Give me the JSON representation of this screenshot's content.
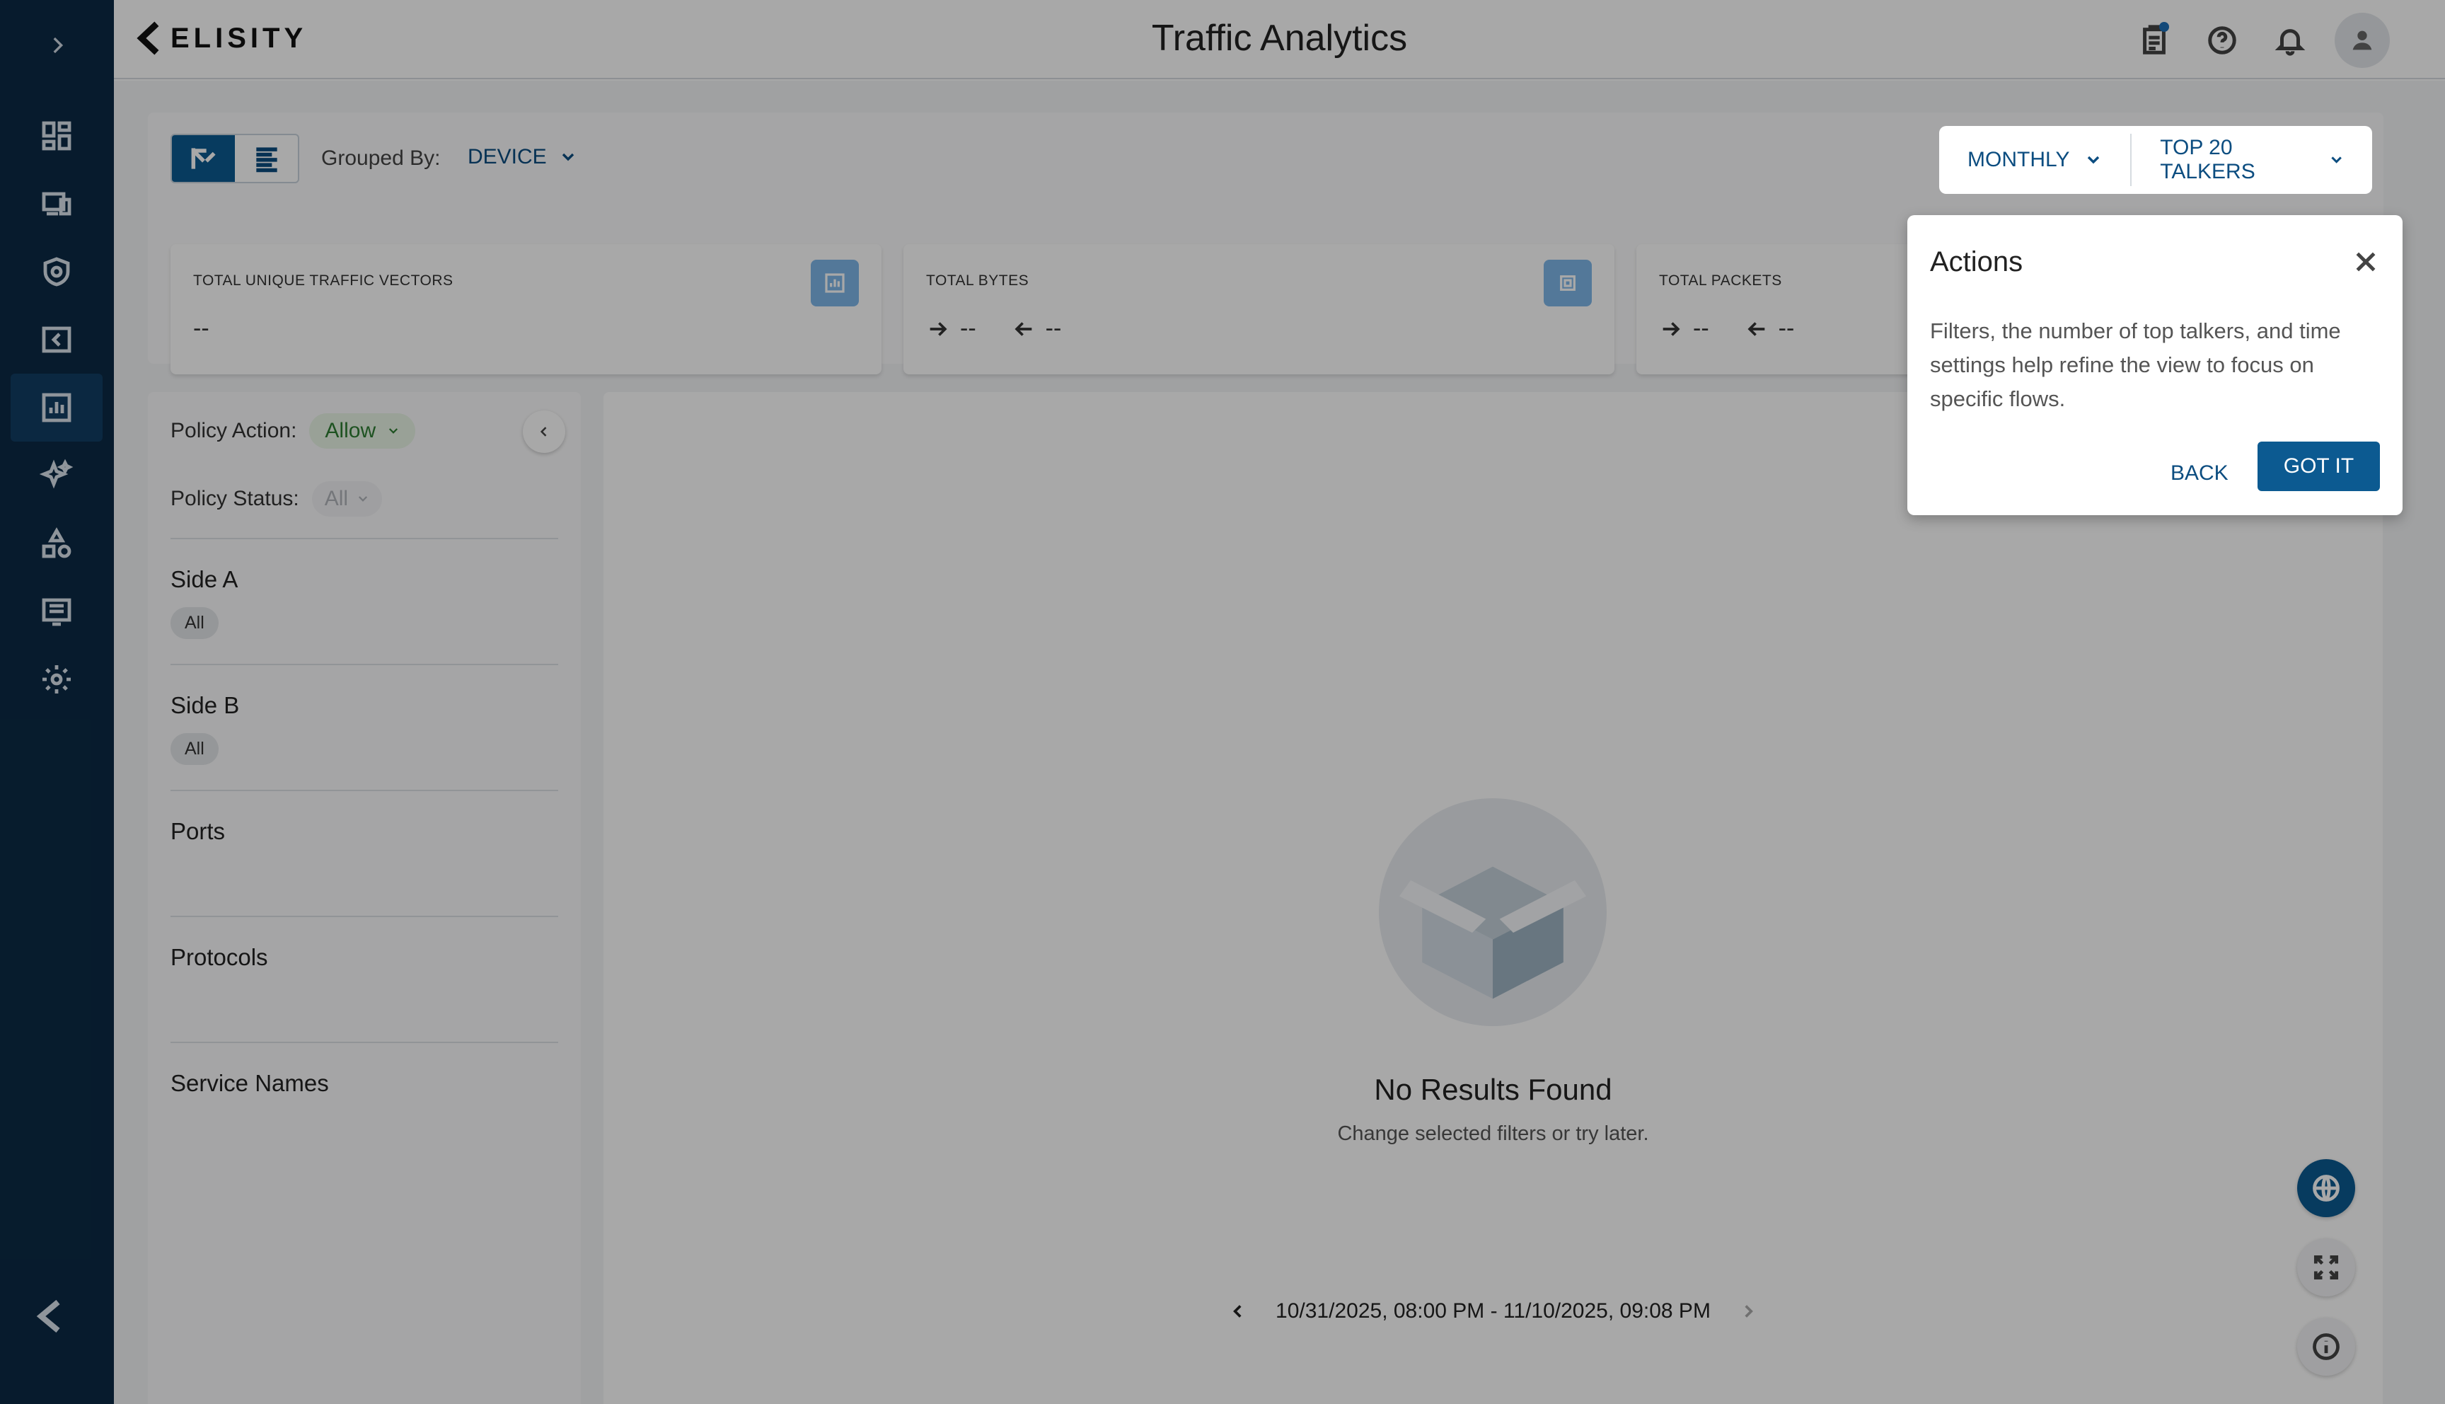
{
  "app": {
    "brand": "ELISITY",
    "title": "Traffic Analytics"
  },
  "header": {
    "icons": [
      "task-list-icon",
      "help-icon",
      "bell-icon",
      "user-avatar-icon"
    ]
  },
  "sidebar": {
    "items": [
      {
        "name": "dashboard-icon",
        "active": false
      },
      {
        "name": "devices-icon",
        "active": false
      },
      {
        "name": "policy-shield-icon",
        "active": false
      },
      {
        "name": "logo-box-icon",
        "active": false
      },
      {
        "name": "analytics-icon",
        "active": true
      },
      {
        "name": "sparkle-icon",
        "active": false
      },
      {
        "name": "shapes-icon",
        "active": false
      },
      {
        "name": "logs-icon",
        "active": false
      },
      {
        "name": "settings-icon",
        "active": false
      }
    ]
  },
  "toolbar": {
    "grouped_label": "Grouped By:",
    "grouped_value": "DEVICE",
    "period": "MONTHLY",
    "talkers": "TOP 20 TALKERS"
  },
  "stats": [
    {
      "label": "TOTAL UNIQUE TRAFFIC VECTORS",
      "value": "--"
    },
    {
      "label": "TOTAL BYTES",
      "out": "--",
      "in": "--"
    },
    {
      "label": "TOTAL PACKETS",
      "out": "--",
      "in": "--"
    }
  ],
  "filters": {
    "policy_action_label": "Policy Action:",
    "policy_action_value": "Allow",
    "policy_status_label": "Policy Status:",
    "policy_status_value": "All",
    "sections": [
      {
        "title": "Side A",
        "chip": "All"
      },
      {
        "title": "Side B",
        "chip": "All"
      },
      {
        "title": "Ports"
      },
      {
        "title": "Protocols"
      },
      {
        "title": "Service Names"
      }
    ]
  },
  "empty": {
    "title": "No Results Found",
    "subtitle": "Change selected filters or try later."
  },
  "date_range": "10/31/2025, 08:00 PM - 11/10/2025, 09:08 PM",
  "popover": {
    "title": "Actions",
    "body": "Filters, the number of top talkers, and time settings help refine the view to focus on specific flows.",
    "back": "BACK",
    "got_it": "GOT IT"
  },
  "colors": {
    "sidebar": "#0b2a45",
    "primary": "#0c5a91",
    "accent_light": "#7fb7e9",
    "allow_green": "#2e7d32"
  }
}
